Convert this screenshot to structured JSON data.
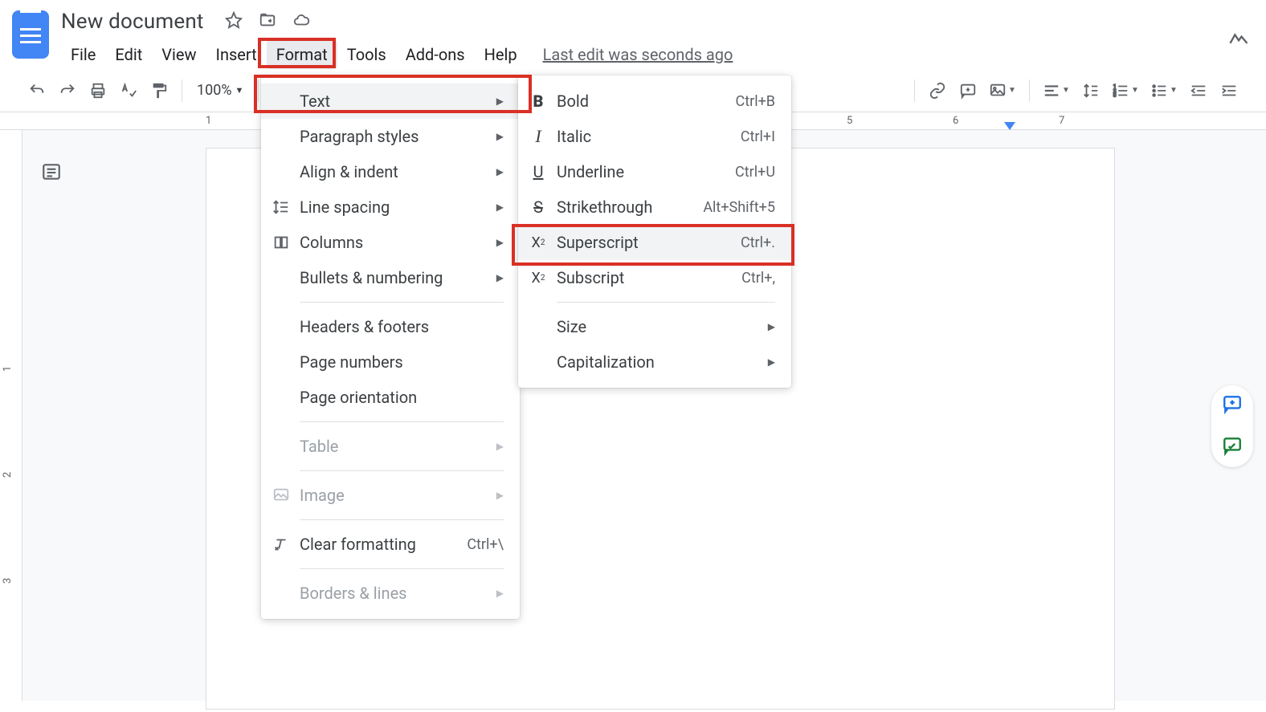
{
  "header": {
    "title": "New document",
    "last_edit": "Last edit was seconds ago"
  },
  "menu": {
    "file": "File",
    "edit": "Edit",
    "view": "View",
    "insert": "Insert",
    "format": "Format",
    "tools": "Tools",
    "addons": "Add-ons",
    "help": "Help"
  },
  "toolbar": {
    "zoom": "100%"
  },
  "ruler": {
    "n1": "1",
    "n5": "5",
    "n6": "6",
    "n7": "7"
  },
  "vruler": {
    "n1": "1",
    "n2": "2",
    "n3": "3"
  },
  "format_menu": {
    "text": "Text",
    "paragraph_styles": "Paragraph styles",
    "align_indent": "Align & indent",
    "line_spacing": "Line spacing",
    "columns": "Columns",
    "bullets_numbering": "Bullets & numbering",
    "headers_footers": "Headers & footers",
    "page_numbers": "Page numbers",
    "page_orientation": "Page orientation",
    "table": "Table",
    "image": "Image",
    "clear_formatting": "Clear formatting",
    "clear_shortcut": "Ctrl+\\",
    "borders_lines": "Borders & lines"
  },
  "text_menu": {
    "bold": "Bold",
    "bold_sc": "Ctrl+B",
    "italic": "Italic",
    "italic_sc": "Ctrl+I",
    "underline": "Underline",
    "underline_sc": "Ctrl+U",
    "strike": "Strikethrough",
    "strike_sc": "Alt+Shift+5",
    "superscript": "Superscript",
    "super_sc": "Ctrl+.",
    "subscript": "Subscript",
    "sub_sc": "Ctrl+,",
    "size": "Size",
    "capitalization": "Capitalization"
  }
}
